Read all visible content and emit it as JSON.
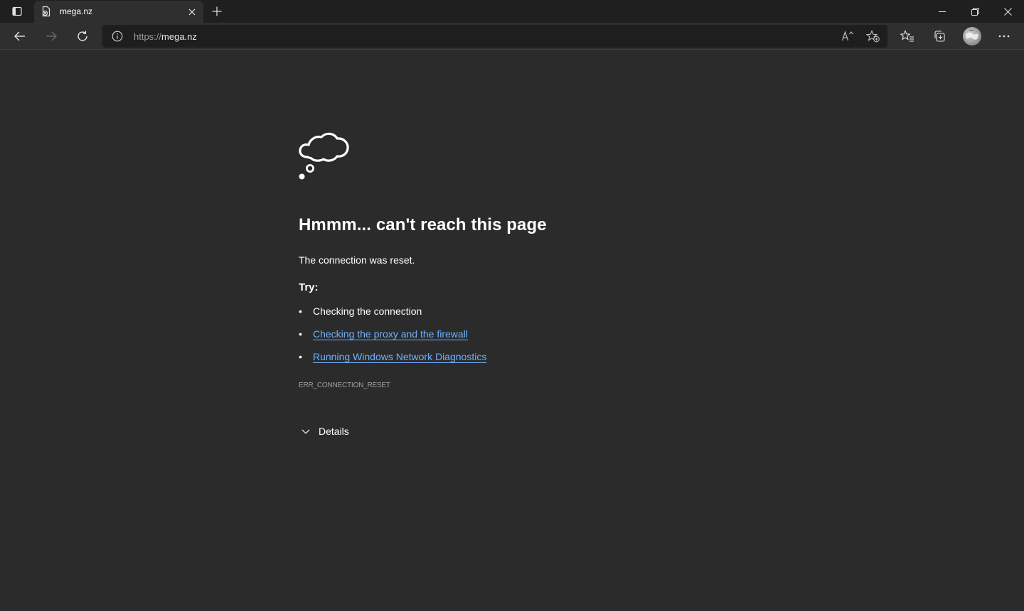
{
  "tab": {
    "title": "mega.nz"
  },
  "address_bar": {
    "url_scheme": "https://",
    "url_host": "mega.nz"
  },
  "icons": {
    "tab_actions": "tab-actions-icon",
    "favicon": "page-error-icon",
    "tab_close": "close-icon",
    "new_tab": "plus-icon",
    "minimize": "minimize-icon",
    "restore": "restore-icon",
    "close_window": "close-icon",
    "back": "back-arrow-icon",
    "forward": "forward-arrow-icon",
    "refresh": "refresh-icon",
    "site_info": "info-icon",
    "read_aloud": "read-aloud-icon",
    "add_favorite": "add-favorite-icon",
    "favorites": "favorites-icon",
    "collections": "collections-icon",
    "profile": "avatar",
    "more": "more-icon",
    "illustration": "thought-cloud-icon",
    "details": "chevron-down-icon"
  },
  "error_page": {
    "heading": "Hmmm... can't reach this page",
    "message": "The connection was reset.",
    "try_label": "Try:",
    "suggestions": [
      {
        "text": "Checking the connection",
        "is_link": false
      },
      {
        "text": "Checking the proxy and the firewall",
        "is_link": true
      },
      {
        "text": "Running Windows Network Diagnostics",
        "is_link": true
      }
    ],
    "error_code": "ERR_CONNECTION_RESET",
    "details_label": "Details"
  },
  "colors": {
    "page_background": "#2b2b2b",
    "titlebar_background": "#1f1f1f",
    "toolbar_background": "#2f2f2f",
    "link": "#6fb1ff"
  }
}
